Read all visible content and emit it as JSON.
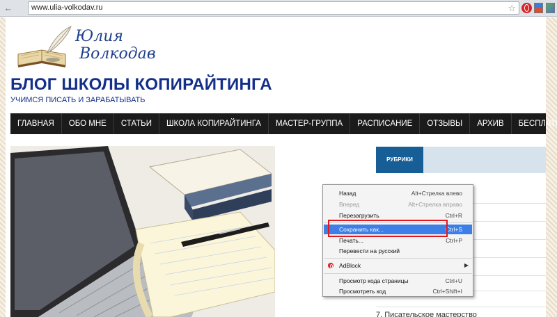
{
  "browser": {
    "url": "www.ulia-volkodav.ru",
    "back_glyph": "←",
    "page_glyph": "▭",
    "star_glyph": "☆"
  },
  "site": {
    "logo_line1": "Юлия",
    "logo_line2": "Волкодав",
    "title": "БЛОГ ШКОЛЫ КОПИРАЙТИНГА",
    "subtitle": "УЧИМСЯ ПИСАТЬ И ЗАРАБАТЫВАТЬ"
  },
  "menu": [
    {
      "label": "ГЛАВНАЯ"
    },
    {
      "label": "ОБО МНЕ"
    },
    {
      "label": "СТАТЬИ"
    },
    {
      "label": "ШКОЛА КОПИРАЙТИНГА"
    },
    {
      "label": "МАСТЕР-ГРУППА"
    },
    {
      "label": "РАСПИСАНИЕ"
    },
    {
      "label": "ОТЗЫВЫ"
    },
    {
      "label": "АРХИВ"
    },
    {
      "label": "БЕСПЛАТНО"
    }
  ],
  "sidebar": {
    "rubriki_label": "РУБРИКИ",
    "link_partial": "7. Писательское мастерство"
  },
  "context_menu": {
    "items": [
      {
        "label": "Назад",
        "shortcut": "Alt+Стрелка влево"
      },
      {
        "label": "Вперед",
        "shortcut": "Alt+Стрелка вправо"
      },
      {
        "label": "Перезагрузить",
        "shortcut": "Ctrl+R"
      },
      {
        "label": "Сохранить как...",
        "shortcut": "Ctrl+S"
      },
      {
        "label": "Печать...",
        "shortcut": "Ctrl+P"
      },
      {
        "label": "Перевести на русский",
        "shortcut": ""
      },
      {
        "label": "AdBlock",
        "shortcut": ""
      },
      {
        "label": "Просмотр кода страницы",
        "shortcut": "Ctrl+U"
      },
      {
        "label": "Просмотреть код",
        "shortcut": "Ctrl+Shift+I"
      }
    ],
    "submenu_arrow": "▶"
  },
  "colors": {
    "brand_blue": "#132f8a",
    "menu_bg": "#1b1b1b",
    "highlight": "#3d7fe6",
    "annotation_red": "#e3181d"
  }
}
